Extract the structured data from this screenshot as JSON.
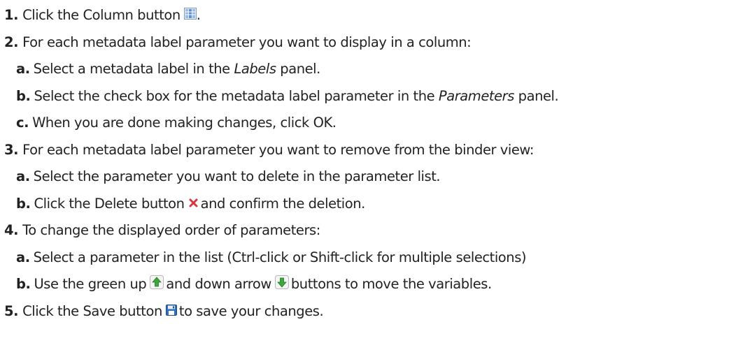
{
  "steps": [
    {
      "number": "1.",
      "parts": [
        "Click the Column button",
        "."
      ],
      "icon": "column-icon"
    },
    {
      "number": "2.",
      "text": "For each metadata label parameter you want to display in a column:",
      "substeps": [
        {
          "letter": "a.",
          "before": "Select a metadata label in the ",
          "em": "Labels",
          "after": " panel."
        },
        {
          "letter": "b.",
          "before": "Select the check box for the metadata label parameter in the ",
          "em": "Parameters",
          "after": " panel."
        },
        {
          "letter": "c.",
          "text": "When you are done making changes, click OK."
        }
      ]
    },
    {
      "number": "3.",
      "text": "For each metadata label parameter you want to remove from the binder view:",
      "substeps": [
        {
          "letter": "a.",
          "text": "Select the parameter you want to delete in the parameter list."
        },
        {
          "letter": "b.",
          "before": "Click the Delete button",
          "after": "and confirm the deletion.",
          "icon": "delete-icon"
        }
      ]
    },
    {
      "number": "4.",
      "text": "To change the displayed order of parameters:",
      "substeps": [
        {
          "letter": "a.",
          "text": "Select a parameter in the list (Ctrl-click or Shift-click for multiple selections)"
        },
        {
          "letter": "b.",
          "before": "Use the green up",
          "middle": "and down arrow",
          "after": "buttons to move the variables.",
          "icons": [
            "green-up-arrow-icon",
            "green-down-arrow-icon"
          ]
        }
      ]
    },
    {
      "number": "5.",
      "parts": [
        "Click the Save button",
        "to save your changes."
      ],
      "icon": "save-icon"
    }
  ],
  "colors": {
    "text": "#222222",
    "delete_icon": "#d9363e",
    "arrow_green": "#3aa83a",
    "save_icon": "#2f6fc0",
    "column_icon": "#5b8fd6"
  }
}
